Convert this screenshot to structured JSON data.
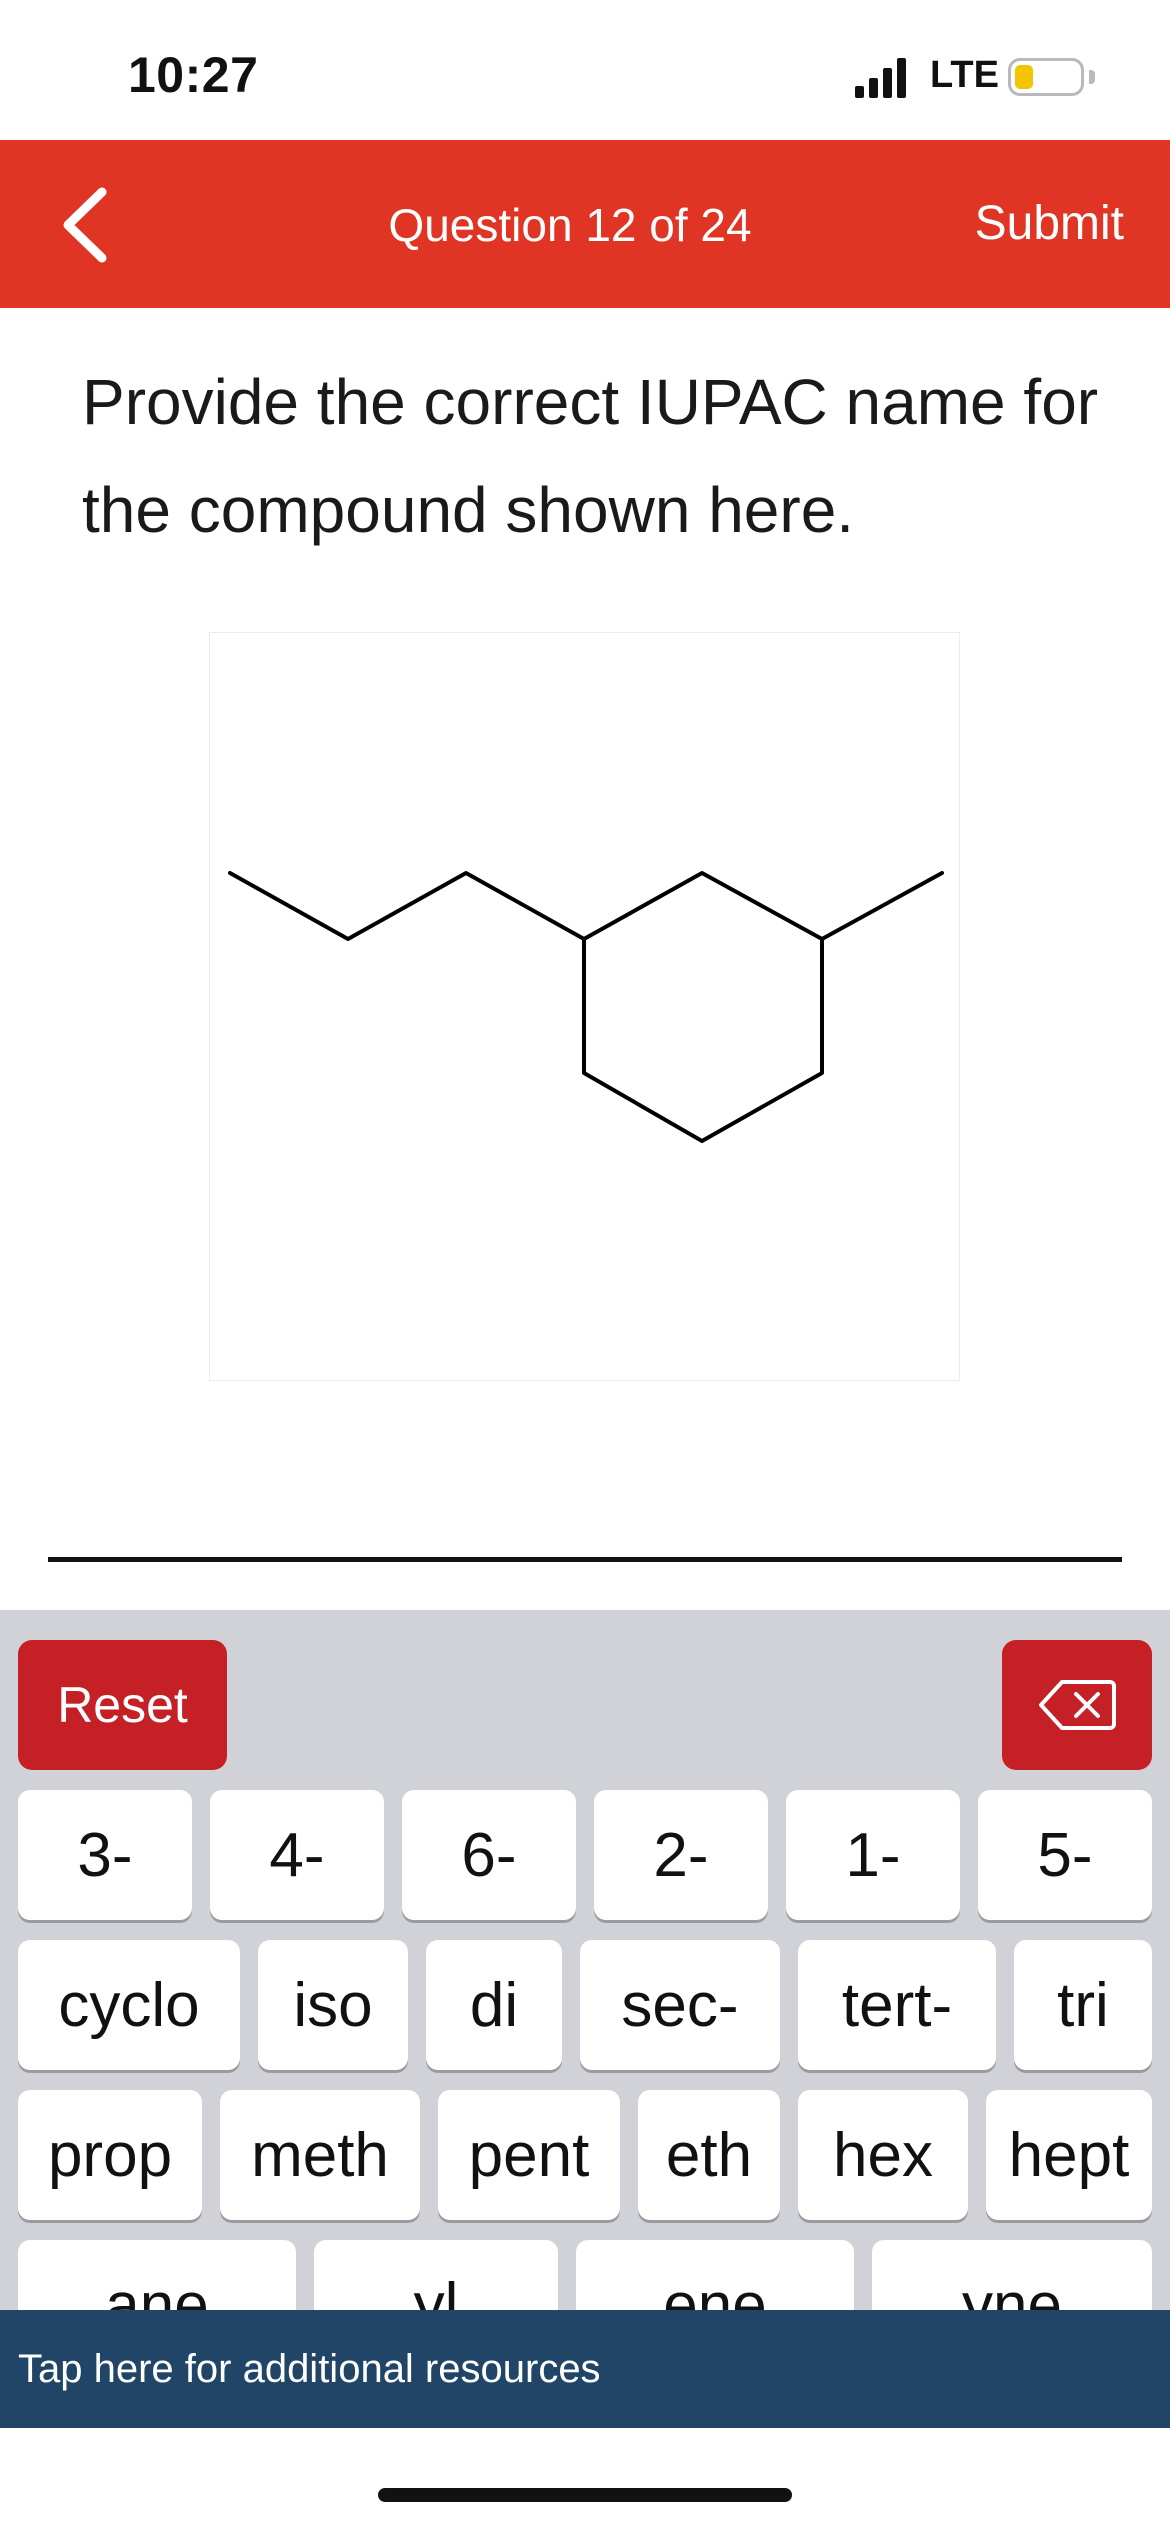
{
  "status_bar": {
    "time": "10:27",
    "network": "LTE",
    "battery_color": "#f5c400"
  },
  "header": {
    "title": "Question 12 of 24",
    "submit_label": "Submit",
    "back_icon": "chevron-left-icon",
    "background": "#e03524"
  },
  "question": {
    "prompt": "Provide the correct IUPAC name for the compound shown here."
  },
  "keyboard": {
    "reset_label": "Reset",
    "backspace_icon": "backspace-icon",
    "button_color": "#c42026",
    "rows": [
      [
        "3-",
        "4-",
        "6-",
        "2-",
        "1-",
        "5-"
      ],
      [
        "cyclo",
        "iso",
        "di",
        "sec-",
        "tert-",
        "tri"
      ],
      [
        "prop",
        "meth",
        "pent",
        "eth",
        "hex",
        "hept"
      ],
      [
        "ane",
        "yl",
        "ene",
        "yne"
      ]
    ]
  },
  "resources": {
    "label": "Tap here for additional resources",
    "background": "#204567"
  }
}
